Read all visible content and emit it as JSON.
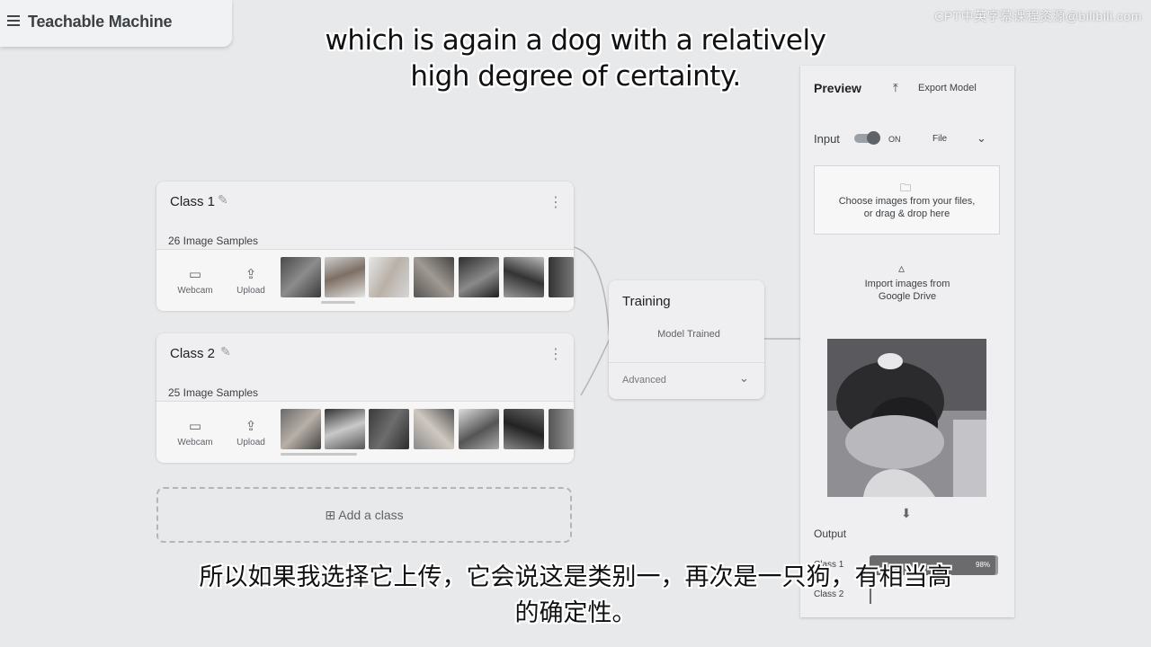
{
  "app": {
    "title": "Teachable Machine"
  },
  "watermark": "CPT中英字幕课程资源@bilibili.com",
  "subtitles": {
    "en_line1": "which is again a dog with a relatively",
    "en_line2": "high degree of certainty.",
    "zh_line1": "所以如果我选择它上传，它会说这是类别一，再次是一只狗，有相当高",
    "zh_line2": "的确定性。"
  },
  "classes": [
    {
      "name": "Class 1",
      "samples_label": "26 Image Samples",
      "webcam_label": "Webcam",
      "upload_label": "Upload"
    },
    {
      "name": "Class 2",
      "samples_label": "25 Image Samples",
      "webcam_label": "Webcam",
      "upload_label": "Upload"
    }
  ],
  "add_class": {
    "icon": "plus-square-icon",
    "label": "Add a class"
  },
  "training": {
    "title": "Training",
    "status": "Model Trained",
    "advanced_label": "Advanced"
  },
  "preview": {
    "title": "Preview",
    "export_label": "Export Model",
    "input_label": "Input",
    "toggle_state": "ON",
    "source_select": "File",
    "dropzone_line1": "Choose images from your files,",
    "dropzone_line2": "or drag & drop here",
    "drive_line1": "Import images from",
    "drive_line2": "Google Drive",
    "output_label": "Output",
    "outputs": [
      {
        "label": "Class 1",
        "percent_text": "98%",
        "fraction": 0.98
      },
      {
        "label": "Class 2",
        "percent_text": "",
        "fraction": 0.02
      }
    ]
  },
  "colors": {
    "background": "#e8e9eb",
    "card": "#efeff1",
    "bar": "#6b6b6e"
  }
}
